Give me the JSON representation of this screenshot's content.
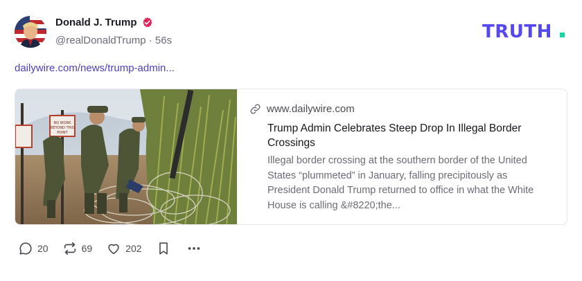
{
  "post": {
    "author": {
      "display_name": "Donald J. Trump",
      "handle": "@realDonaldTrump",
      "separator": "·",
      "time": "56s",
      "verified_color": "#e0245e"
    },
    "brand": "TRUTH.",
    "brand_colors": {
      "text": "#5448ee",
      "dot": "#17d6a8"
    },
    "link_text": "dailywire.com/news/trump-admin...",
    "card": {
      "domain": "www.dailywire.com",
      "title": "Trump Admin Celebrates Steep Drop In Illegal Border Crossings",
      "description": "Illegal border crossing at the southern border of the United States “plummeted” in January, falling precipitously as President Donald Trump returned to office in what the White House is calling &#8220;the...",
      "image_sign_text": "NO WORK BEYOND THIS POINT"
    },
    "actions": {
      "replies": "20",
      "retruths": "69",
      "likes": "202"
    }
  }
}
